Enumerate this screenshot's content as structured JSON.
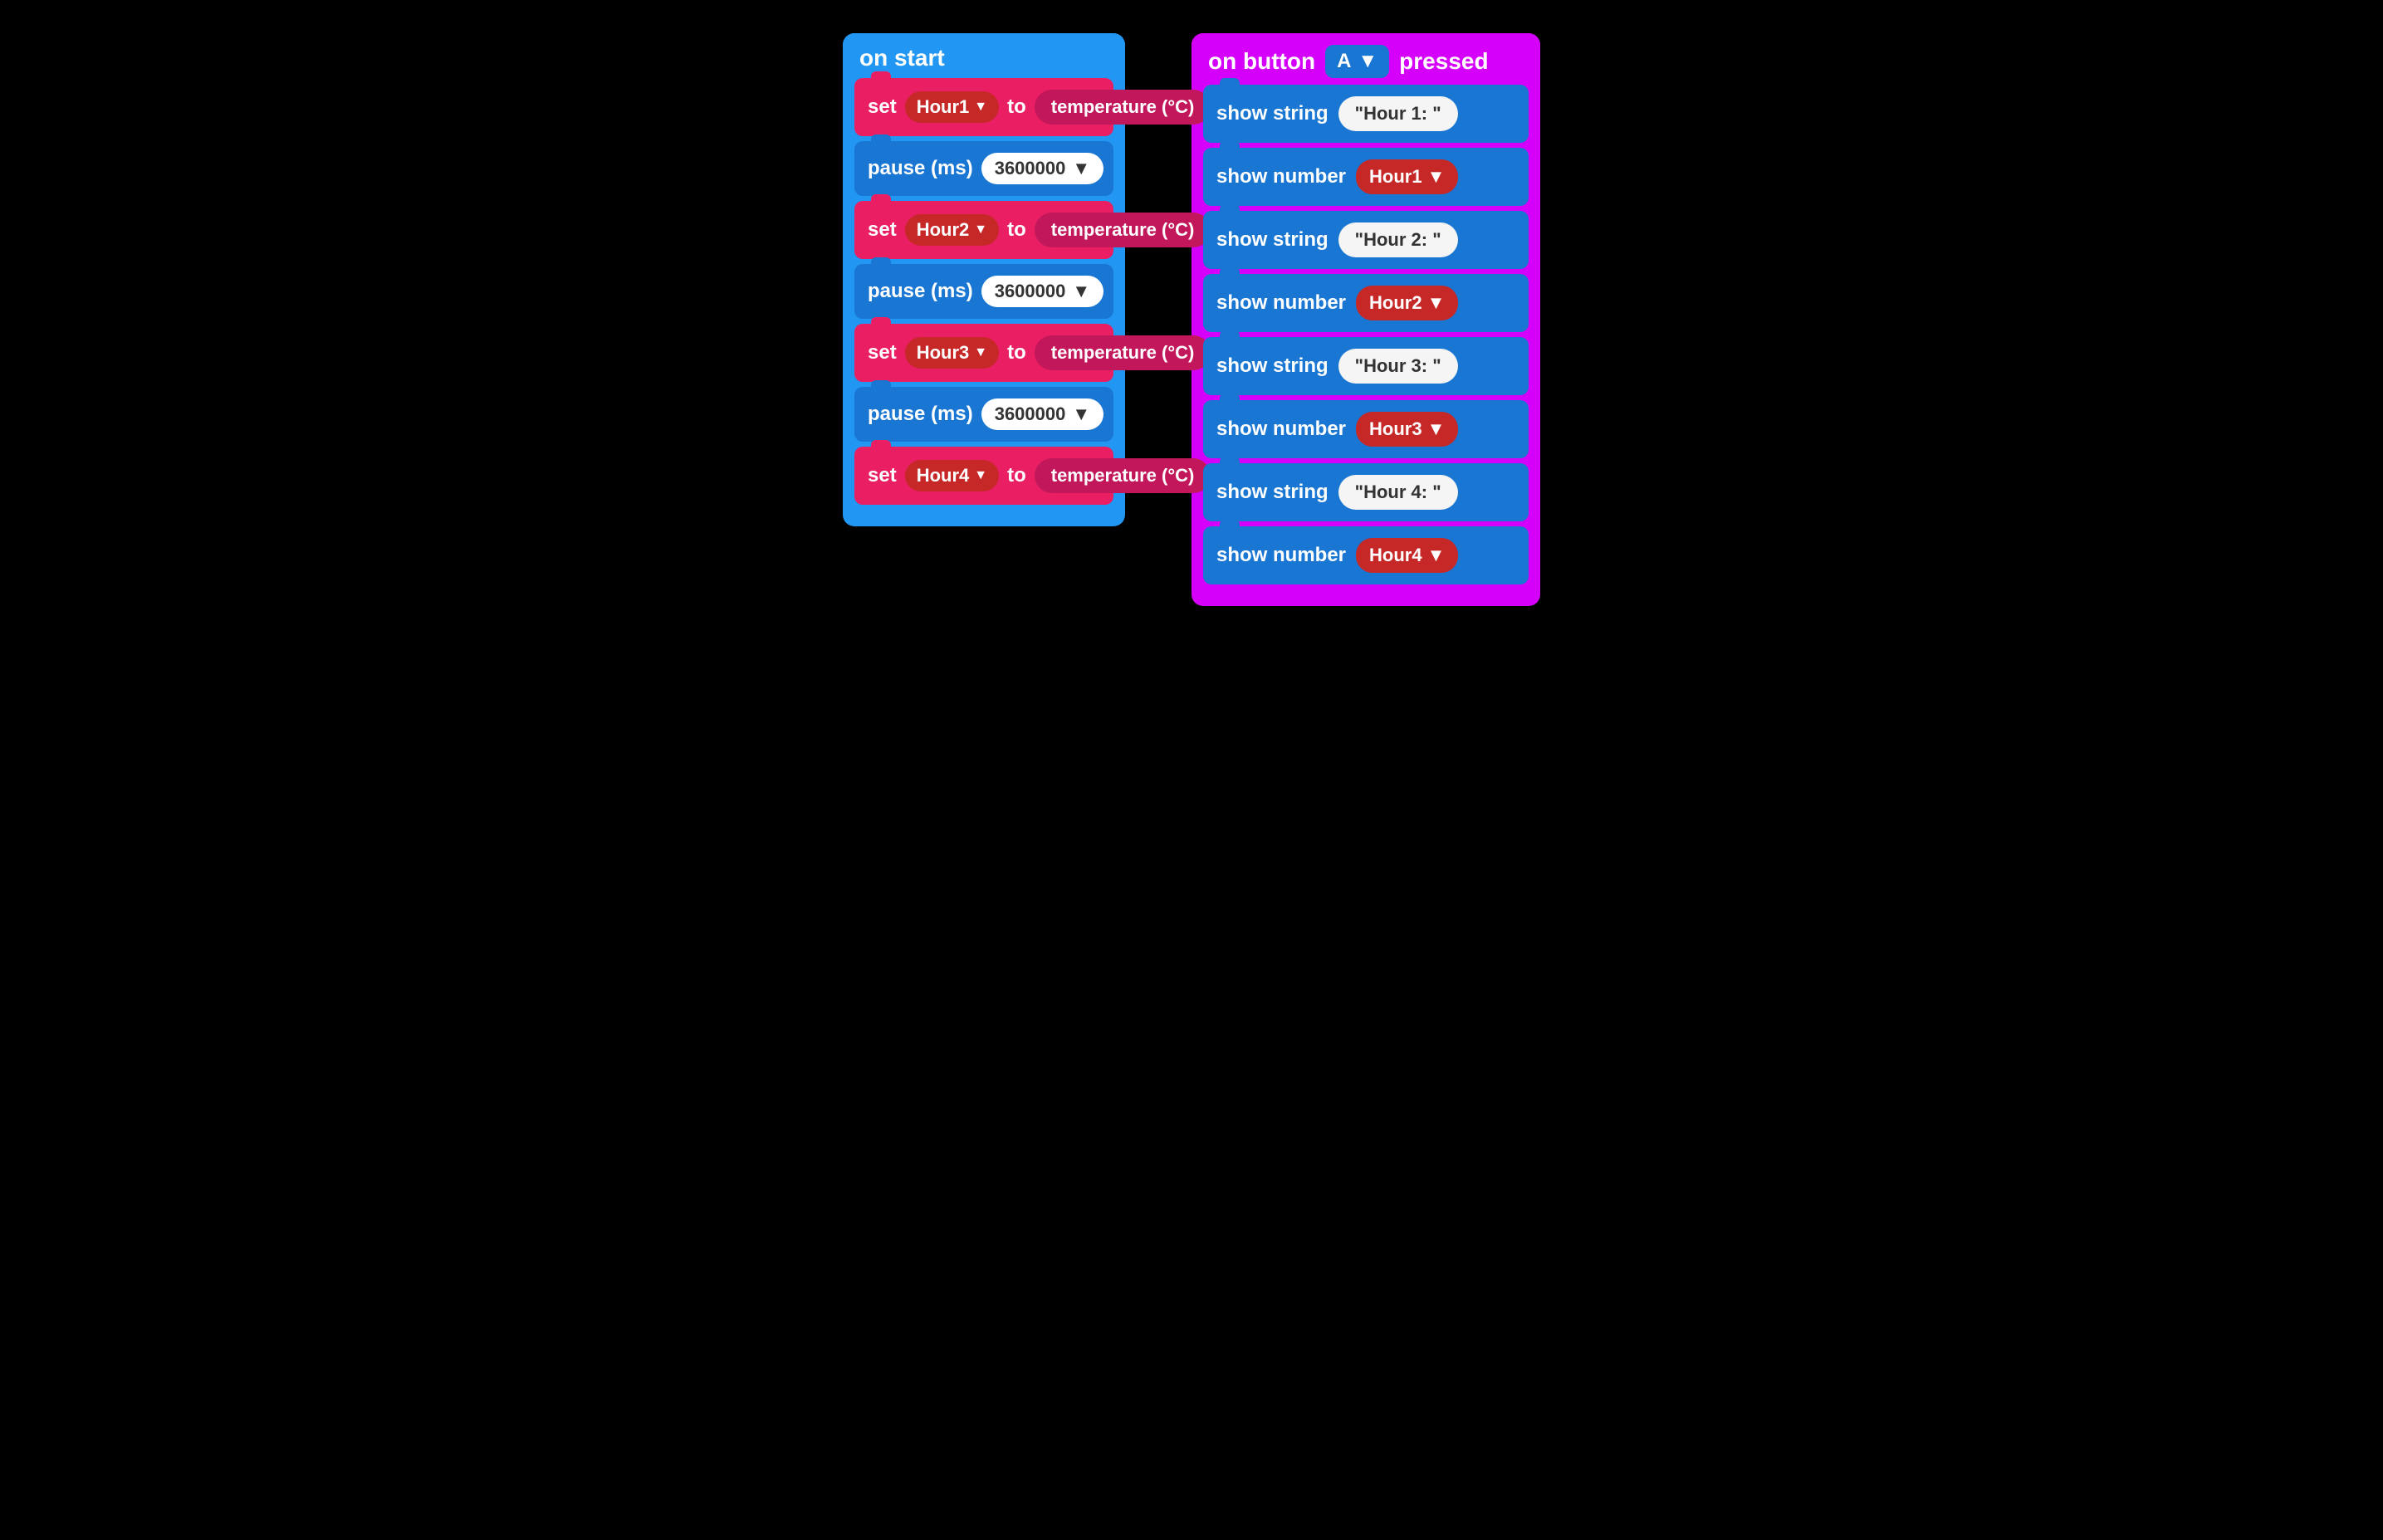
{
  "left": {
    "hat_label": "on start",
    "blocks": [
      {
        "type": "set",
        "var": "Hour1",
        "label_set": "set",
        "label_to": "to",
        "value": "temperature (°C)"
      },
      {
        "type": "pause",
        "label": "pause (ms)",
        "value": "3600000"
      },
      {
        "type": "set",
        "var": "Hour2",
        "label_set": "set",
        "label_to": "to",
        "value": "temperature (°C)"
      },
      {
        "type": "pause",
        "label": "pause (ms)",
        "value": "3600000"
      },
      {
        "type": "set",
        "var": "Hour3",
        "label_set": "set",
        "label_to": "to",
        "value": "temperature (°C)"
      },
      {
        "type": "pause",
        "label": "pause (ms)",
        "value": "3600000"
      },
      {
        "type": "set",
        "var": "Hour4",
        "label_set": "set",
        "label_to": "to",
        "value": "temperature (°C)"
      }
    ]
  },
  "right": {
    "hat_prefix": "on button",
    "hat_button": "A",
    "hat_suffix": "pressed",
    "blocks": [
      {
        "type": "show_string",
        "label": "show string",
        "value": "\"Hour 1:  \""
      },
      {
        "type": "show_number",
        "label": "show number",
        "var": "Hour1"
      },
      {
        "type": "show_string",
        "label": "show string",
        "value": "\"Hour 2:  \""
      },
      {
        "type": "show_number",
        "label": "show number",
        "var": "Hour2"
      },
      {
        "type": "show_string",
        "label": "show string",
        "value": "\"Hour 3:  \""
      },
      {
        "type": "show_number",
        "label": "show number",
        "var": "Hour3"
      },
      {
        "type": "show_string",
        "label": "show string",
        "value": "\"Hour 4:  \""
      },
      {
        "type": "show_number",
        "label": "show number",
        "var": "Hour4"
      }
    ]
  },
  "colors": {
    "blue_bg": "#2196f3",
    "red_block": "#e91e63",
    "dark_red": "#c62828",
    "purple": "#d500f9",
    "pause_blue": "#1976d2"
  }
}
